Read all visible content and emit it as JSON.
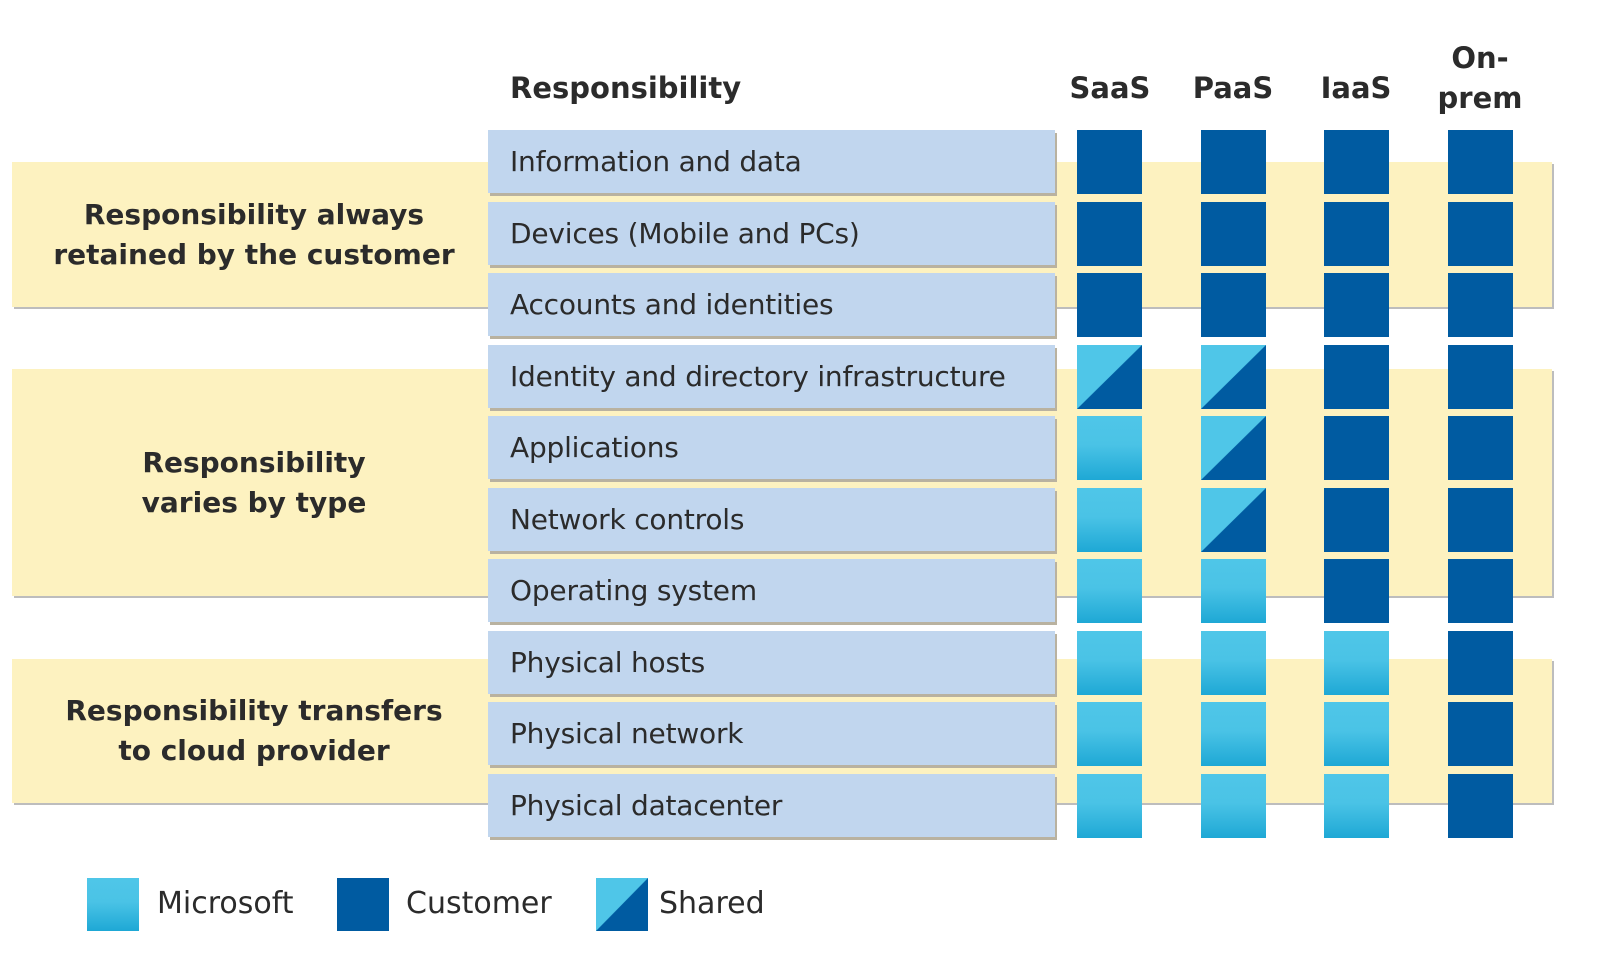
{
  "header": {
    "responsibility": "Responsibility",
    "columns": [
      "SaaS",
      "PaaS",
      "IaaS",
      "On-\nprem"
    ]
  },
  "colors": {
    "microsoft": "#4FC6E8",
    "microsoft_dark": "#1EA8D5",
    "customer": "#005BA1",
    "band": "#FDF2C0",
    "row": "#C1D6EE"
  },
  "bands": [
    {
      "label": "Responsibility always\nretained by the customer"
    },
    {
      "label": "Responsibility\nvaries by type"
    },
    {
      "label": "Responsibility transfers\nto cloud provider"
    }
  ],
  "rows": [
    {
      "label": "Information and data",
      "values": [
        "customer",
        "customer",
        "customer",
        "customer"
      ]
    },
    {
      "label": "Devices (Mobile and PCs)",
      "values": [
        "customer",
        "customer",
        "customer",
        "customer"
      ]
    },
    {
      "label": "Accounts and identities",
      "values": [
        "customer",
        "customer",
        "customer",
        "customer"
      ]
    },
    {
      "label": "Identity and directory infrastructure",
      "values": [
        "shared",
        "shared",
        "customer",
        "customer"
      ]
    },
    {
      "label": "Applications",
      "values": [
        "microsoft",
        "shared",
        "customer",
        "customer"
      ]
    },
    {
      "label": "Network controls",
      "values": [
        "microsoft",
        "shared",
        "customer",
        "customer"
      ]
    },
    {
      "label": "Operating system",
      "values": [
        "microsoft",
        "microsoft",
        "customer",
        "customer"
      ]
    },
    {
      "label": "Physical hosts",
      "values": [
        "microsoft",
        "microsoft",
        "microsoft",
        "customer"
      ]
    },
    {
      "label": "Physical network",
      "values": [
        "microsoft",
        "microsoft",
        "microsoft",
        "customer"
      ]
    },
    {
      "label": "Physical datacenter",
      "values": [
        "microsoft",
        "microsoft",
        "microsoft",
        "customer"
      ]
    }
  ],
  "legend": [
    {
      "key": "microsoft",
      "label": "Microsoft"
    },
    {
      "key": "customer",
      "label": "Customer"
    },
    {
      "key": "shared",
      "label": "Shared"
    }
  ]
}
